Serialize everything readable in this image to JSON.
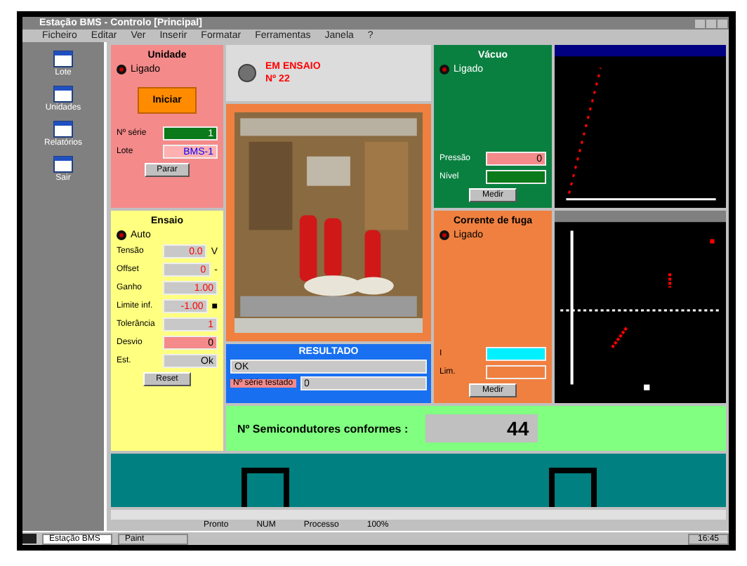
{
  "window": {
    "title": "Estação BMS - Controlo [Principal]"
  },
  "menu": [
    "Ficheiro",
    "Editar",
    "Ver",
    "Inserir",
    "Formatar",
    "Ferramentas",
    "Janela",
    "?"
  ],
  "sidebar": {
    "items": [
      {
        "label": "Lote"
      },
      {
        "label": "Unidades"
      },
      {
        "label": "Relatórios"
      },
      {
        "label": "Sair"
      }
    ]
  },
  "unit_panel": {
    "title": "Unidade",
    "radio": {
      "label": "Ligado",
      "selected": true
    },
    "start_button": "Iniciar",
    "fields": [
      {
        "label": "Nº série",
        "value": "1",
        "kind": "green"
      },
      {
        "label": "Lote",
        "value": "BMS-1",
        "kind": "blue"
      }
    ],
    "button": "Parar"
  },
  "header": {
    "lines": [
      "EM ENSAIO",
      "Nº 22"
    ]
  },
  "vacuum_panel": {
    "title": "Vácuo",
    "radio": {
      "label": "Ligado",
      "selected": true
    },
    "fields": [
      {
        "label": "Pressão",
        "value": "0",
        "kind": "pink"
      },
      {
        "label": "Nível",
        "kind": "green"
      }
    ],
    "button": "Medir"
  },
  "test_panel": {
    "title": "Ensaio",
    "radio": {
      "label": "Auto",
      "selected": true
    },
    "fields": [
      {
        "label": "Tensão",
        "value": "0.0",
        "unit": "V"
      },
      {
        "label": "Offset",
        "value": "0",
        "unit": "-"
      },
      {
        "label": "Ganho",
        "value": "1.00"
      },
      {
        "label": "Limite inf.",
        "value": "-1.00",
        "unit": "■"
      }
    ],
    "tolerance": {
      "label": "Tolerância",
      "value": "1"
    },
    "deviation": {
      "label": "Desvio",
      "value": "0"
    },
    "status": {
      "label": "Est.",
      "value": "Ok"
    },
    "button": "Reset"
  },
  "result_panel": {
    "title": "RESULTADO",
    "value": "OK",
    "serial_label": "Nº série testado",
    "serial_value": "0"
  },
  "leakage_panel": {
    "title": "Corrente de fuga",
    "radio": {
      "label": "Ligado",
      "selected": true
    },
    "fields": [
      {
        "label": "I",
        "kind": "cyan"
      },
      {
        "label": "Lim.",
        "kind": "orange"
      }
    ],
    "button": "Medir"
  },
  "count_bar": {
    "label": "Nº Semicondutores conformes :",
    "value": "44"
  },
  "status_bar": [
    "Pronto",
    "NUM",
    "Processo",
    "100%"
  ],
  "taskbar": {
    "tasks": [
      {
        "label": "Estação BMS",
        "selected": true
      },
      {
        "label": "Paint",
        "selected": false
      }
    ],
    "clock": "16:45"
  }
}
